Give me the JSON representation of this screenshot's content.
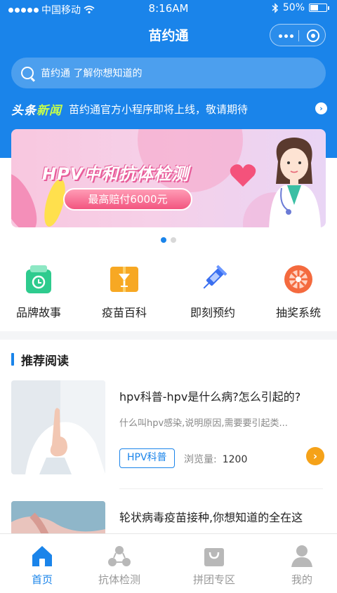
{
  "status_bar": {
    "carrier": "中国移动",
    "time": "8:16AM",
    "battery": "50%",
    "battery_level": 0.5
  },
  "nav": {
    "title": "苗约通"
  },
  "search": {
    "placeholder": "苗约通 了解你想知道的"
  },
  "headline": {
    "logo_part1": "头条",
    "logo_part2": "新闻",
    "text": "苗约通官方小程序即将上线，敬请期待"
  },
  "banner": {
    "title": "HPV中和抗体检测",
    "pill": "最高赔付6000元",
    "slides": 2,
    "active_slide": 1
  },
  "entries": [
    {
      "label": "品牌故事",
      "icon": "brand-story-icon",
      "color": "#2ecb8e"
    },
    {
      "label": "疫苗百科",
      "icon": "vaccine-encyclopedia-icon",
      "color": "#f7a823"
    },
    {
      "label": "即刻预约",
      "icon": "syringe-icon",
      "color": "#3a6ff0"
    },
    {
      "label": "抽奖系统",
      "icon": "lottery-wheel-icon",
      "color": "#f46a3e"
    }
  ],
  "recommended": {
    "heading": "推荐阅读",
    "articles": [
      {
        "title": "hpv科普-hpv是什么病?怎么引起的?",
        "desc": "什么叫hpv感染,说明原因,需要要引起类...",
        "tag": "HPV科普",
        "views_label": "浏览量:",
        "views": "1200"
      },
      {
        "title": "轮状病毒疫苗接种,你想知道的全在这"
      }
    ]
  },
  "tabbar": [
    {
      "label": "首页",
      "icon": "home-icon",
      "active": true
    },
    {
      "label": "抗体检测",
      "icon": "antibody-test-icon",
      "active": false
    },
    {
      "label": "拼团专区",
      "icon": "group-buy-bag-icon",
      "active": false
    },
    {
      "label": "我的",
      "icon": "profile-icon",
      "active": false
    }
  ],
  "colors": {
    "brand": "#1a84ea",
    "accent_orange": "#f5a219"
  }
}
